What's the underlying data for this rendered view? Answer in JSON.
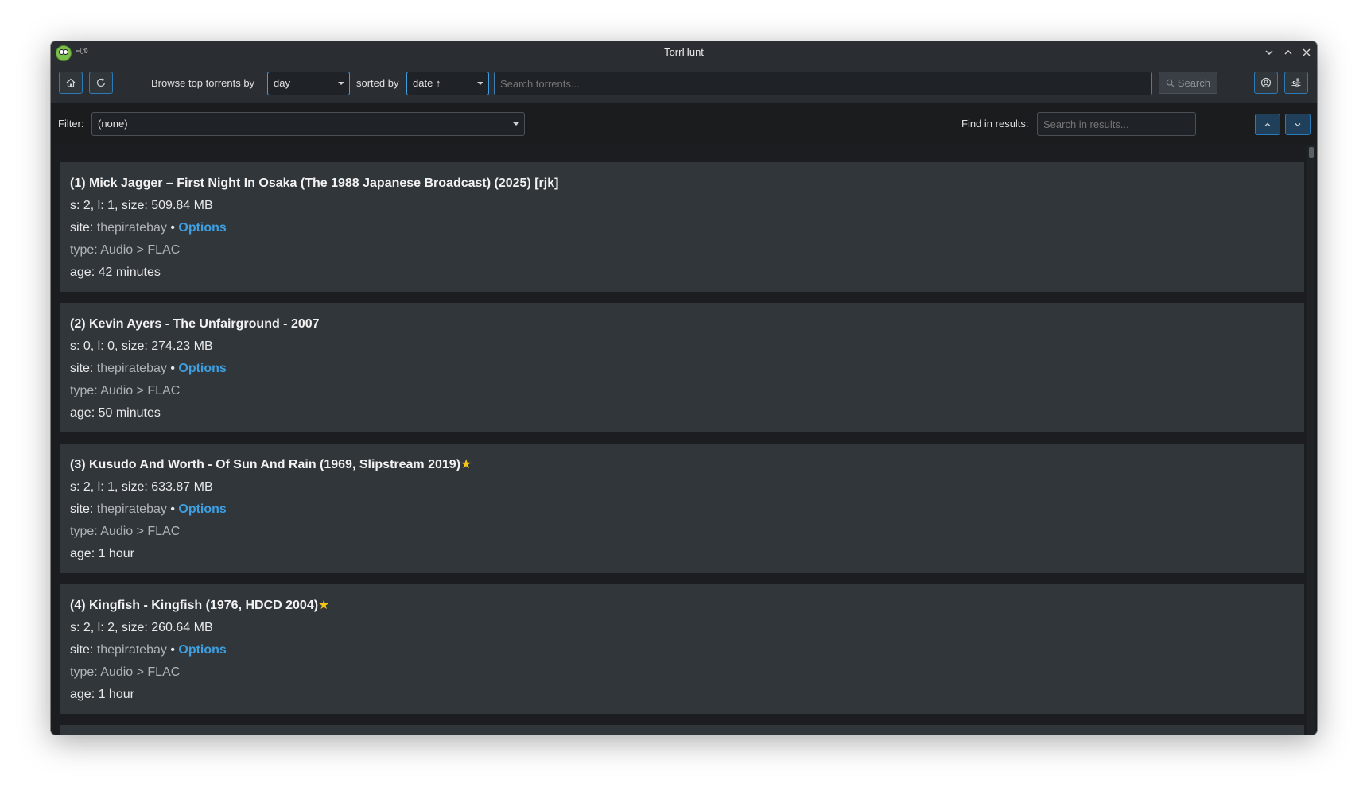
{
  "window": {
    "title": "TorrHunt"
  },
  "toolbar": {
    "browse_label": "Browse top torrents by",
    "period_value": "day",
    "sorted_label": "sorted by",
    "sort_value": "date ↑",
    "search_placeholder": "Search torrents...",
    "search_button": "Search"
  },
  "filterbar": {
    "filter_label": "Filter:",
    "filter_value": "(none)",
    "find_label": "Find in results:",
    "find_placeholder": "Search in results..."
  },
  "results": [
    {
      "title": "(1) Mick Jagger – First Night In Osaka (The 1988 Japanese Broadcast) (2025) [rjk]",
      "starred": false,
      "stats": "s: 2, l: 1, size: 509.84 MB",
      "site_prefix": "site:",
      "site": "thepiratebay",
      "sep": "•",
      "options": "Options",
      "type": "type: Audio > FLAC",
      "age": "age: 42 minutes"
    },
    {
      "title": "(2) Kevin Ayers - The Unfairground - 2007",
      "starred": false,
      "stats": "s: 0, l: 0, size: 274.23 MB",
      "site_prefix": "site:",
      "site": "thepiratebay",
      "sep": "•",
      "options": "Options",
      "type": "type: Audio > FLAC",
      "age": "age: 50 minutes"
    },
    {
      "title": "(3) Kusudo And Worth - Of Sun And Rain (1969, Slipstream 2019)",
      "starred": true,
      "stats": "s: 2, l: 1, size: 633.87 MB",
      "site_prefix": "site:",
      "site": "thepiratebay",
      "sep": "•",
      "options": "Options",
      "type": "type: Audio > FLAC",
      "age": "age: 1 hour"
    },
    {
      "title": "(4) Kingfish - Kingfish (1976, HDCD 2004)",
      "starred": true,
      "stats": "s: 2, l: 2, size: 260.64 MB",
      "site_prefix": "site:",
      "site": "thepiratebay",
      "sep": "•",
      "options": "Options",
      "type": "type: Audio > FLAC",
      "age": "age: 1 hour"
    }
  ],
  "icons": {
    "star": "★",
    "star_color": "#f5c518",
    "accent": "#3d9ee0"
  }
}
